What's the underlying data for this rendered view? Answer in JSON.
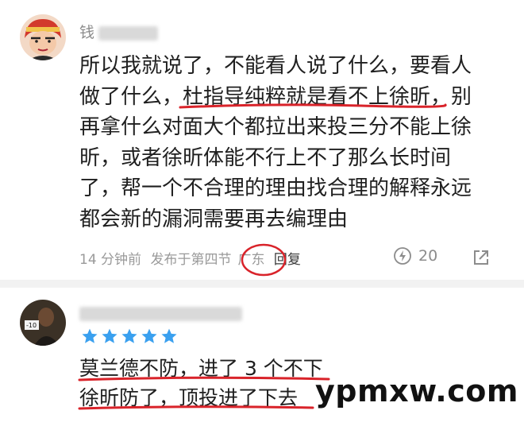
{
  "comments": [
    {
      "username": "钱",
      "text_lines": [
        "所以我就说了，不能看人说了什么，要看人",
        "做了什么，杜指导纯粹就是看不上徐昕，别",
        "再拿什么对面大个都拉出来投三分不能上徐",
        "昕，或者徐昕体能不行上不了那么长时间",
        "了，帮一个不合理的理由找合理的解释永远",
        "都会新的漏洞需要再去编理由"
      ],
      "time": "14 分钟前",
      "posted_in": "发布于第四节",
      "location": "广东",
      "reply_label": "回复",
      "likes": "20",
      "avatar_icon": "cartoon-avatar-icon",
      "like_icon": "lightning-like-icon",
      "share_icon": "share-icon"
    },
    {
      "username": "",
      "rating_stars": 5,
      "text_lines": [
        "莫兰德不防，进了 3 个不下",
        "徐昕防了，顶投进了下去"
      ],
      "avatar_icon": "photo-avatar-icon",
      "avatar_sign": "-10"
    }
  ],
  "watermark": "ypmxw.com",
  "colors": {
    "annotation_red": "#d9232a",
    "star_blue": "#3aa0ef",
    "meta_gray": "#9a9a9a"
  }
}
